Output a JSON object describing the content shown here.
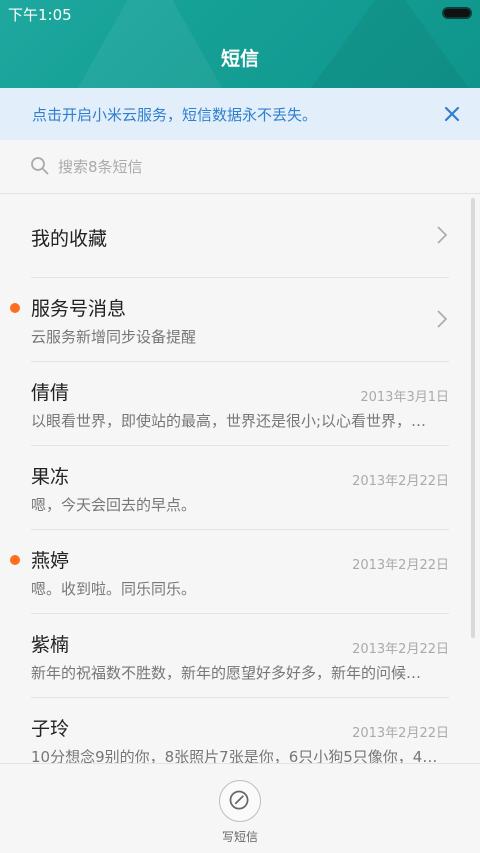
{
  "status_bar": {
    "time": "下午1:05"
  },
  "header": {
    "title": "短信"
  },
  "banner": {
    "text": "点击开启小米云服务，短信数据永不丢失。"
  },
  "search": {
    "placeholder": "搜索8条短信"
  },
  "list": {
    "favorites": {
      "name": "我的收藏"
    },
    "service": {
      "name": "服务号消息",
      "snippet": "云服务新增同步设备提醒"
    },
    "conversations": [
      {
        "name": "倩倩",
        "date": "2013年3月1日",
        "snippet": "以眼看世界，即使站的最高，世界还是很小;以心看世界，…",
        "unread": false
      },
      {
        "name": "果冻",
        "date": "2013年2月22日",
        "snippet": "嗯，今天会回去的早点。",
        "unread": false
      },
      {
        "name": "燕婷",
        "date": "2013年2月22日",
        "snippet": "嗯。收到啦。同乐同乐。",
        "unread": true
      },
      {
        "name": "紫楠",
        "date": "2013年2月22日",
        "snippet": "新年的祝福数不胜数，新年的愿望好多好多，新年的问候…",
        "unread": false
      },
      {
        "name": "子玲",
        "date": "2013年2月22日",
        "snippet": "10分想念9别的你，8张照片7张是你，6只小狗5只像你，4…",
        "unread": false
      }
    ]
  },
  "bottom": {
    "compose_label": "写短信"
  },
  "colors": {
    "header": "#15a096",
    "unread_dot": "#ff6d1f",
    "banner_text": "#2f7fd0"
  }
}
